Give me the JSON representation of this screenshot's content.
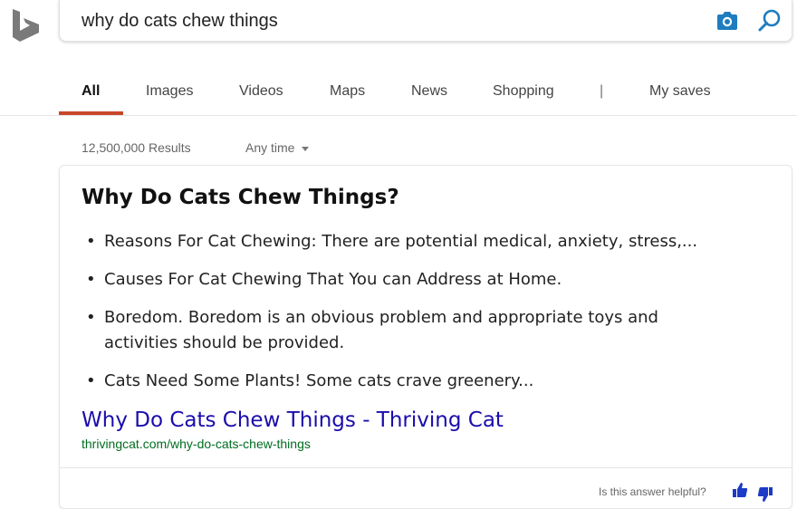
{
  "search": {
    "query": "why do cats chew things"
  },
  "icons": {
    "logo": "bing-logo-icon",
    "camera": "camera-icon",
    "search": "search-icon",
    "caret": "caret-down-icon",
    "thumbs_up": "thumbs-up-icon",
    "thumbs_down": "thumbs-down-icon"
  },
  "colors": {
    "accent": "#c8472a",
    "icon_blue": "#1e7cc0",
    "link": "#1a0dab",
    "url_green": "#006d21",
    "feedback_blue": "#1c3bc6"
  },
  "tabs": [
    {
      "label": "All",
      "active": true
    },
    {
      "label": "Images",
      "active": false
    },
    {
      "label": "Videos",
      "active": false
    },
    {
      "label": "Maps",
      "active": false
    },
    {
      "label": "News",
      "active": false
    },
    {
      "label": "Shopping",
      "active": false
    },
    {
      "label": "My saves",
      "active": false
    }
  ],
  "tab_separator": "|",
  "results": {
    "count": "12,500,000 Results",
    "time_filter": "Any time"
  },
  "answer": {
    "title": "Why Do Cats Chew Things?",
    "bullets": [
      "Reasons For Cat Chewing: There are potential medical, anxiety, stress,...",
      "Causes For Cat Chewing That You can Address at Home.",
      "Boredom. Boredom is an obvious problem and appropriate toys and activities should be provided.",
      "Cats Need Some Plants! Some cats crave greenery..."
    ],
    "link_title": "Why Do Cats Chew Things - Thriving Cat",
    "link_url": "thrivingcat.com/why-do-cats-chew-things",
    "feedback_prompt": "Is this answer helpful?"
  }
}
